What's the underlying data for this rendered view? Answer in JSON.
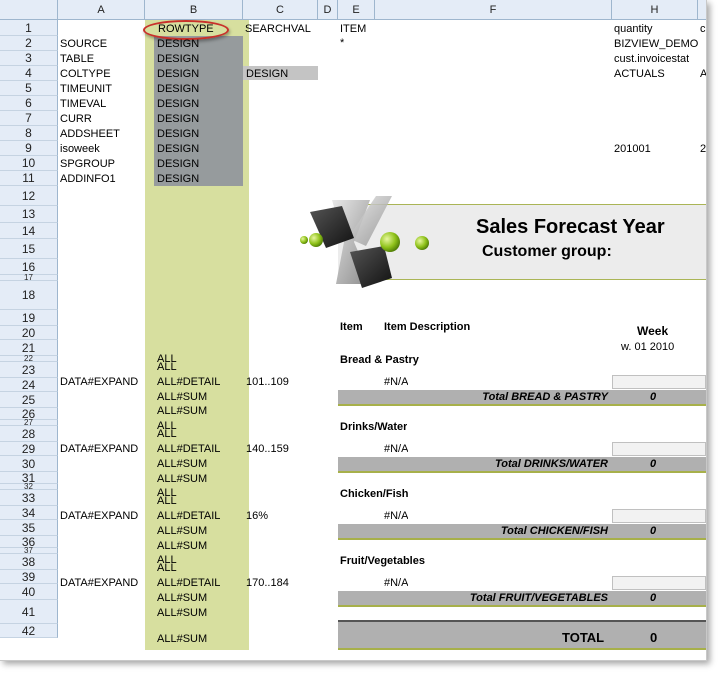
{
  "columns": [
    "A",
    "B",
    "C",
    "D",
    "E",
    "F",
    "H"
  ],
  "rows": [
    "1",
    "2",
    "3",
    "4",
    "5",
    "6",
    "7",
    "8",
    "9",
    "10",
    "11",
    "12",
    "13",
    "14",
    "15",
    "16",
    "17",
    "18",
    "19",
    "20",
    "21",
    "22",
    "23",
    "24",
    "25",
    "26",
    "27",
    "28",
    "29",
    "30",
    "31",
    "32",
    "33",
    "34",
    "35",
    "36",
    "37",
    "38",
    "39",
    "40",
    "41",
    "42"
  ],
  "header_cells": {
    "b1": "ROWTYPE",
    "c1": "SEARCHVAL",
    "e1": "ITEM",
    "h1": "quantity",
    "i1": "c",
    "e2": "*",
    "h2": "BIZVIEW_DEMO",
    "h3": "cust.invoicestat",
    "h4": "ACTUALS",
    "i4": "A",
    "h9": "201001",
    "i9": "2"
  },
  "row_labels": [
    "SOURCE",
    "TABLE",
    "COLTYPE",
    "TIMEUNIT",
    "TIMEVAL",
    "CURR",
    "ADDSHEET",
    "isoweek",
    "SPGROUP",
    "ADDINFO1"
  ],
  "design_label": "DESIGN",
  "c4_value": "DESIGN",
  "report": {
    "title": "Sales Forecast Year",
    "subtitle": "Customer group:",
    "col_item": "Item",
    "col_desc": "Item Description",
    "col_week": "Week",
    "week_value": "w. 01 2010"
  },
  "groups": [
    {
      "name": "Bread & Pastry",
      "expand": "DATA#EXPAND",
      "detail": "ALL#DETAIL",
      "search": "101..109",
      "na": "#N/A",
      "total_label": "Total BREAD & PASTRY",
      "total": "0"
    },
    {
      "name": "Drinks/Water",
      "expand": "DATA#EXPAND",
      "detail": "ALL#DETAIL",
      "search": "140..159",
      "na": "#N/A",
      "total_label": "Total DRINKS/WATER",
      "total": "0"
    },
    {
      "name": "Chicken/Fish",
      "expand": "DATA#EXPAND",
      "detail": "ALL#DETAIL",
      "search": "16%",
      "na": "#N/A",
      "total_label": "Total CHICKEN/FISH",
      "total": "0"
    },
    {
      "name": "Fruit/Vegetables",
      "expand": "DATA#EXPAND",
      "detail": "ALL#DETAIL",
      "search": "170..184",
      "na": "#N/A",
      "total_label": "Total FRUIT/VEGETABLES",
      "total": "0"
    }
  ],
  "all_label": "ALL",
  "sum_label": "ALL#SUM",
  "grand_total": {
    "label": "TOTAL",
    "value": "0"
  },
  "colors": {
    "highlight_oval": "#c8312b",
    "column_b": "#d7df9f",
    "design_block": "#969b9d",
    "accent_line": "#a7b04a"
  }
}
